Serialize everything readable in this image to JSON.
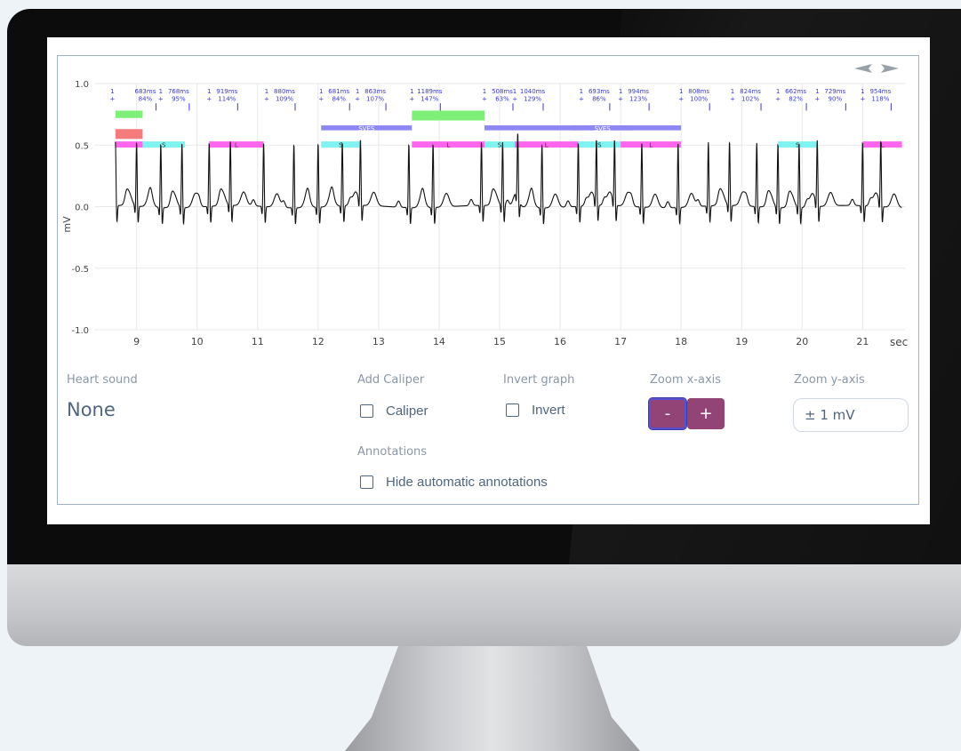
{
  "chart_data": {
    "type": "line",
    "ylabel": "mV",
    "xunit": "sec",
    "xlim": [
      8.3,
      21.7
    ],
    "ylim": [
      -1.0,
      1.0
    ],
    "xticks": [
      "9",
      "10",
      "11",
      "12",
      "13",
      "14",
      "15",
      "16",
      "17",
      "18",
      "19",
      "20",
      "21"
    ],
    "yticks": [
      "1.0",
      "0.5",
      "0.0",
      "-0.5",
      "-1.0"
    ],
    "grid": true,
    "series": [
      {
        "r_peaks": [
          8.65,
          9.0,
          9.4,
          9.75,
          10.2,
          10.55,
          11.1,
          11.6,
          12.0,
          12.4,
          12.7,
          13.5,
          13.9,
          14.7,
          15.05,
          15.3,
          15.7,
          16.3,
          16.6,
          16.9,
          17.35,
          17.95,
          18.45,
          18.8,
          19.25,
          19.6,
          19.95,
          20.25,
          21.0,
          21.3
        ]
      }
    ],
    "rr_annotations": [
      {
        "x": 8.6,
        "count": "1",
        "plus": "+",
        "interval": "",
        "pct": ""
      },
      {
        "x": 8.85,
        "count": "",
        "plus": "",
        "interval": "683ms",
        "pct": "84%"
      },
      {
        "x": 9.4,
        "count": "1",
        "plus": "+",
        "interval": "768ms",
        "pct": "95%"
      },
      {
        "x": 10.2,
        "count": "1",
        "plus": "+",
        "interval": "919ms",
        "pct": "114%"
      },
      {
        "x": 11.15,
        "count": "1",
        "plus": "+",
        "interval": "880ms",
        "pct": "109%"
      },
      {
        "x": 12.05,
        "count": "1",
        "plus": "+",
        "interval": "681ms",
        "pct": "84%"
      },
      {
        "x": 12.65,
        "count": "1",
        "plus": "+",
        "interval": "863ms",
        "pct": "107%"
      },
      {
        "x": 13.55,
        "count": "1",
        "plus": "+",
        "interval": "1189ms",
        "pct": "147%"
      },
      {
        "x": 14.75,
        "count": "1",
        "plus": "+",
        "interval": "508ms",
        "pct": "63%"
      },
      {
        "x": 15.25,
        "count": "1",
        "plus": "+",
        "interval": "1040ms",
        "pct": "129%"
      },
      {
        "x": 16.35,
        "count": "1",
        "plus": "+",
        "interval": "693ms",
        "pct": "86%"
      },
      {
        "x": 17.0,
        "count": "1",
        "plus": "+",
        "interval": "994ms",
        "pct": "123%"
      },
      {
        "x": 18.0,
        "count": "1",
        "plus": "+",
        "interval": "808ms",
        "pct": "100%"
      },
      {
        "x": 18.85,
        "count": "1",
        "plus": "+",
        "interval": "824ms",
        "pct": "102%"
      },
      {
        "x": 19.6,
        "count": "1",
        "plus": "+",
        "interval": "662ms",
        "pct": "82%"
      },
      {
        "x": 20.25,
        "count": "1",
        "plus": "+",
        "interval": "729ms",
        "pct": "90%"
      },
      {
        "x": 21.0,
        "count": "1",
        "plus": "+",
        "interval": "954ms",
        "pct": "118%"
      }
    ],
    "bands": [
      {
        "x0": 8.65,
        "x1": 9.1,
        "y0": 0.72,
        "y1": 0.78,
        "color": "#7ef07a",
        "label": ""
      },
      {
        "x0": 8.65,
        "x1": 9.1,
        "y0": 0.55,
        "y1": 0.63,
        "color": "#f47c7c",
        "label": ""
      },
      {
        "x0": 12.05,
        "x1": 13.55,
        "y0": 0.62,
        "y1": 0.66,
        "color": "#8d86f5",
        "label": "SVES"
      },
      {
        "x0": 13.55,
        "x1": 14.75,
        "y0": 0.7,
        "y1": 0.78,
        "color": "#7ef07a",
        "label": ""
      },
      {
        "x0": 14.75,
        "x1": 18.0,
        "y0": 0.62,
        "y1": 0.66,
        "color": "#8d86f5",
        "label": "SVES"
      },
      {
        "x0": 16.2,
        "x1": 17.2,
        "y0": 0.62,
        "y1": 0.66,
        "color": "#8d86f5",
        "label": "SVES"
      },
      {
        "x0": 8.65,
        "x1": 9.1,
        "y0": 0.48,
        "y1": 0.53,
        "color": "#ff66ee",
        "label": ""
      },
      {
        "x0": 9.1,
        "x1": 9.8,
        "y0": 0.48,
        "y1": 0.53,
        "color": "#80f2f2",
        "label": "S"
      },
      {
        "x0": 10.2,
        "x1": 11.1,
        "y0": 0.48,
        "y1": 0.53,
        "color": "#ff66ee",
        "label": "L"
      },
      {
        "x0": 12.05,
        "x1": 12.7,
        "y0": 0.48,
        "y1": 0.53,
        "color": "#80f2f2",
        "label": "S"
      },
      {
        "x0": 13.55,
        "x1": 14.75,
        "y0": 0.48,
        "y1": 0.53,
        "color": "#ff66ee",
        "label": "L"
      },
      {
        "x0": 14.75,
        "x1": 15.25,
        "y0": 0.48,
        "y1": 0.53,
        "color": "#80f2f2",
        "label": "S"
      },
      {
        "x0": 15.25,
        "x1": 16.3,
        "y0": 0.48,
        "y1": 0.53,
        "color": "#ff66ee",
        "label": "L"
      },
      {
        "x0": 16.3,
        "x1": 17.0,
        "y0": 0.48,
        "y1": 0.53,
        "color": "#80f2f2",
        "label": "S"
      },
      {
        "x0": 17.0,
        "x1": 18.0,
        "y0": 0.48,
        "y1": 0.53,
        "color": "#ff66ee",
        "label": "L"
      },
      {
        "x0": 19.6,
        "x1": 20.25,
        "y0": 0.48,
        "y1": 0.53,
        "color": "#80f2f2",
        "label": "S"
      },
      {
        "x0": 21.0,
        "x1": 21.65,
        "y0": 0.48,
        "y1": 0.53,
        "color": "#ff66ee",
        "label": "L"
      }
    ]
  },
  "controls": {
    "heart_sound": {
      "label": "Heart sound",
      "value": "None"
    },
    "add_caliper": {
      "label": "Add Caliper",
      "checkbox_label": "Caliper",
      "checked": false
    },
    "invert_graph": {
      "label": "Invert graph",
      "checkbox_label": "Invert",
      "checked": false
    },
    "zoom_x": {
      "label": "Zoom x-axis",
      "minus": "-",
      "plus": "+"
    },
    "zoom_y": {
      "label": "Zoom y-axis",
      "value": "± 1 mV"
    },
    "annotations": {
      "label": "Annotations",
      "checkbox_label": "Hide automatic annotations",
      "checked": false
    }
  },
  "nav": {
    "prev_icon": "arrow-left-icon",
    "next_icon": "arrow-right-icon"
  },
  "colors": {
    "accent": "#934477",
    "trace": "#111111",
    "annotation_text": "#3a3ad0",
    "label": "#8a97a8"
  }
}
